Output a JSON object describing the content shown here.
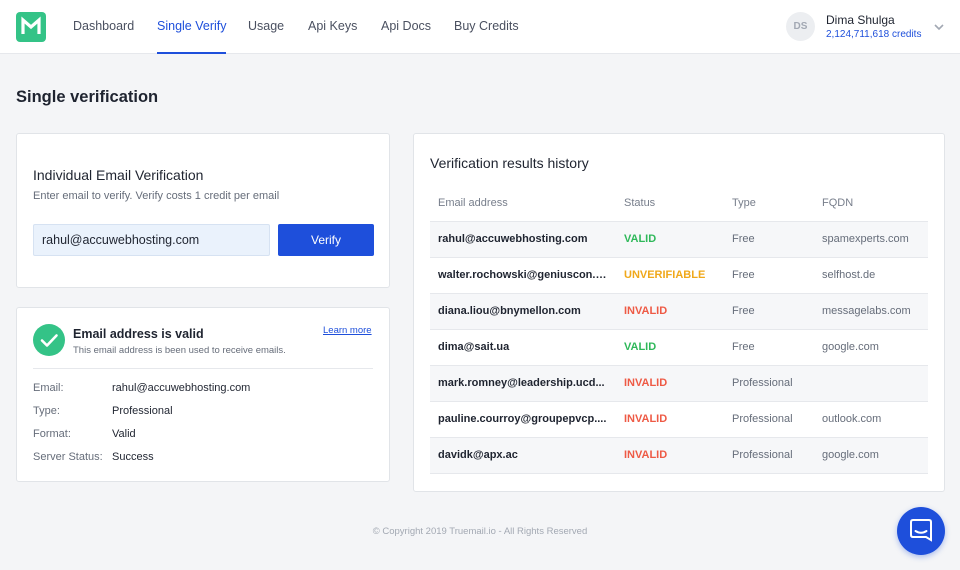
{
  "brand": {
    "logo_letter": "M",
    "accent": "#1e4fdb",
    "green": "#34c387"
  },
  "nav": {
    "items": [
      {
        "label": "Dashboard",
        "active": false
      },
      {
        "label": "Single Verify",
        "active": true
      },
      {
        "label": "Usage",
        "active": false
      },
      {
        "label": "Api Keys",
        "active": false
      },
      {
        "label": "Api Docs",
        "active": false
      },
      {
        "label": "Buy Credits",
        "active": false
      }
    ]
  },
  "user": {
    "initials": "DS",
    "name": "Dima Shulga",
    "credits": "2,124,711,618 credits"
  },
  "page": {
    "title": "Single verification"
  },
  "verify_card": {
    "title": "Individual Email Verification",
    "subtitle": "Enter email to verify. Verify costs 1 credit per email",
    "input_value": "rahul@accuwebhosting.com",
    "button_label": "Verify"
  },
  "result_card": {
    "icon": "check-icon",
    "title": "Email address is valid",
    "subtitle": "This email address is been used to receive emails.",
    "learn_more": "Learn more",
    "details": [
      {
        "label": "Email:",
        "value": "rahul@accuwebhosting.com"
      },
      {
        "label": "Type:",
        "value": "Professional"
      },
      {
        "label": "Format:",
        "value": "Valid"
      },
      {
        "label": "Server Status:",
        "value": "Success"
      }
    ]
  },
  "history": {
    "title": "Verification results history",
    "columns": [
      "Email address",
      "Status",
      "Type",
      "FQDN"
    ],
    "rows": [
      {
        "email": "rahul@accuwebhosting.com",
        "status": "VALID",
        "type": "Free",
        "fqdn": "spamexperts.com"
      },
      {
        "email": "walter.rochowski@geniuscon.c...",
        "status": "UNVERIFIABLE",
        "type": "Free",
        "fqdn": "selfhost.de"
      },
      {
        "email": "diana.liou@bnymellon.com",
        "status": "INVALID",
        "type": "Free",
        "fqdn": "messagelabs.com"
      },
      {
        "email": "dima@sait.ua",
        "status": "VALID",
        "type": "Free",
        "fqdn": "google.com"
      },
      {
        "email": "mark.romney@leadership.ucd...",
        "status": "INVALID",
        "type": "Professional",
        "fqdn": ""
      },
      {
        "email": "pauline.courroy@groupepvcp....",
        "status": "INVALID",
        "type": "Professional",
        "fqdn": "outlook.com"
      },
      {
        "email": "davidk@apx.ac",
        "status": "INVALID",
        "type": "Professional",
        "fqdn": "google.com"
      }
    ]
  },
  "status_colors": {
    "VALID": "#2fb85a",
    "INVALID": "#ee5a45",
    "UNVERIFIABLE": "#f0a81a"
  },
  "footer": {
    "copyright": "© Copyright 2019 Truemail.io - All Rights Reserved"
  },
  "chat": {
    "icon": "chat-icon"
  }
}
